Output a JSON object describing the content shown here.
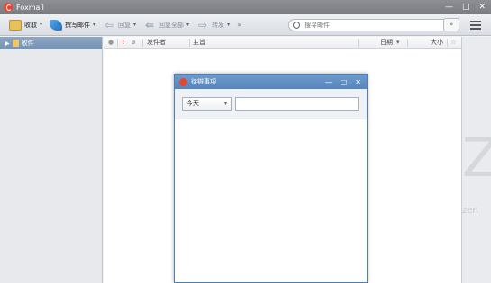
{
  "window": {
    "title": "Foxmail"
  },
  "window_controls": {
    "minimize": "—",
    "maximize": "□",
    "close": "✕"
  },
  "toolbar": {
    "receive_label": "收取",
    "compose_label": "撰写邮件",
    "reply_label": "回复",
    "reply_all_label": "回复全部",
    "forward_label": "转发",
    "more_label": "»",
    "caret": "▾"
  },
  "search": {
    "placeholder": "搜寻邮件",
    "dropdown": "»"
  },
  "sidebar": {
    "items": [
      {
        "label": "收件",
        "arrow": "▶"
      }
    ]
  },
  "mail_list": {
    "columns": {
      "flag": "!",
      "sender": "发件者",
      "subject": "主旨",
      "date": "日期",
      "date_sort": "▾",
      "size": "大小",
      "star": "☆"
    }
  },
  "right_panel": {
    "watermark_big": "Z",
    "watermark_small": "zen"
  },
  "dialog": {
    "title": "待辦事項",
    "controls": {
      "minimize": "—",
      "maximize": "□",
      "close": "✕"
    },
    "filter": {
      "selected": "今天",
      "arrow": "▾"
    },
    "text_value": ""
  }
}
